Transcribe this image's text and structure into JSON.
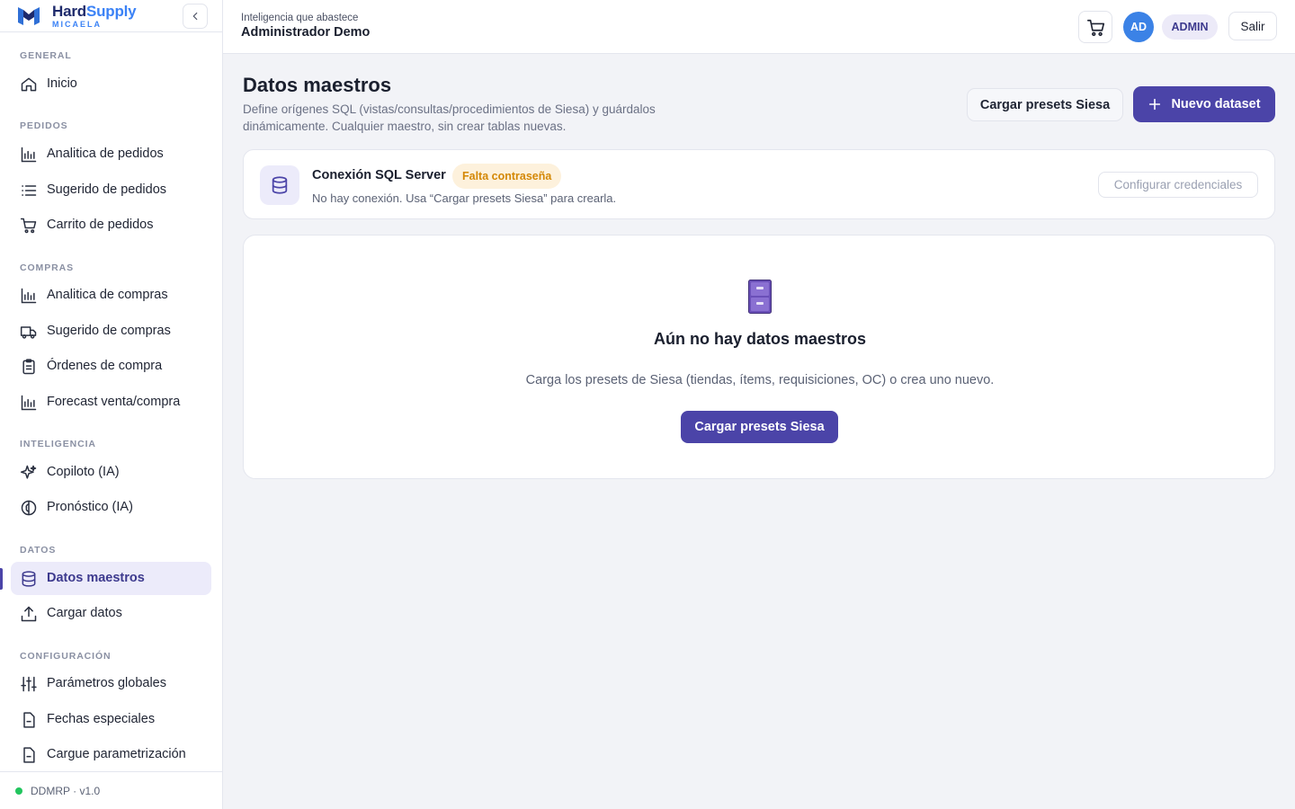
{
  "brand": {
    "name_part1": "Hard",
    "name_part2": "Supply",
    "subtitle": "MICAELA"
  },
  "sidebar": {
    "sections": [
      {
        "title": "GENERAL",
        "items": [
          {
            "label": "Inicio",
            "icon": "home-icon"
          }
        ]
      },
      {
        "title": "PEDIDOS",
        "items": [
          {
            "label": "Analitica de pedidos",
            "icon": "bar-chart-icon"
          },
          {
            "label": "Sugerido de pedidos",
            "icon": "list-icon"
          },
          {
            "label": "Carrito de pedidos",
            "icon": "cart-icon"
          }
        ]
      },
      {
        "title": "COMPRAS",
        "items": [
          {
            "label": "Analitica de compras",
            "icon": "bar-chart-icon"
          },
          {
            "label": "Sugerido de compras",
            "icon": "truck-icon"
          },
          {
            "label": "Órdenes de compra",
            "icon": "clipboard-icon"
          },
          {
            "label": "Forecast venta/compra",
            "icon": "bar-chart-icon"
          }
        ]
      },
      {
        "title": "INTELIGENCIA",
        "items": [
          {
            "label": "Copiloto (IA)",
            "icon": "sparkles-icon"
          },
          {
            "label": "Pronóstico (IA)",
            "icon": "brain-icon"
          }
        ]
      },
      {
        "title": "DATOS",
        "items": [
          {
            "label": "Datos maestros",
            "icon": "database-icon",
            "active": true
          },
          {
            "label": "Cargar datos",
            "icon": "upload-icon"
          }
        ]
      },
      {
        "title": "CONFIGURACIÓN",
        "items": [
          {
            "label": "Parámetros globales",
            "icon": "sliders-icon"
          },
          {
            "label": "Fechas especiales",
            "icon": "file-icon"
          },
          {
            "label": "Cargue parametrización",
            "icon": "file-icon"
          }
        ]
      }
    ],
    "footer": {
      "version": "DDMRP · v1.0",
      "status_color": "#22c55e"
    }
  },
  "topbar": {
    "tagline": "Inteligencia que abastece",
    "user_name": "Administrador Demo",
    "avatar_initials": "AD",
    "role": "ADMIN",
    "logout_label": "Salir"
  },
  "page": {
    "title": "Datos maestros",
    "description": "Define orígenes SQL (vistas/consultas/procedimientos de Siesa) y guárdalos dinámicamente. Cualquier maestro, sin crear tablas nuevas.",
    "load_presets_label": "Cargar presets Siesa",
    "new_dataset_label": "Nuevo dataset"
  },
  "connection": {
    "title": "Conexión SQL Server",
    "badge": "Falta contraseña",
    "description": "No hay conexión. Usa “Cargar presets Siesa” para crearla.",
    "configure_label": "Configurar credenciales"
  },
  "empty_state": {
    "title": "Aún no hay datos maestros",
    "description": "Carga los presets de Siesa (tiendas, ítems, requisiciones, OC) o crea uno nuevo.",
    "button_label": "Cargar presets Siesa"
  },
  "colors": {
    "primary": "#4b44a8",
    "warning": "#d48806",
    "avatar": "#3b82e6"
  }
}
